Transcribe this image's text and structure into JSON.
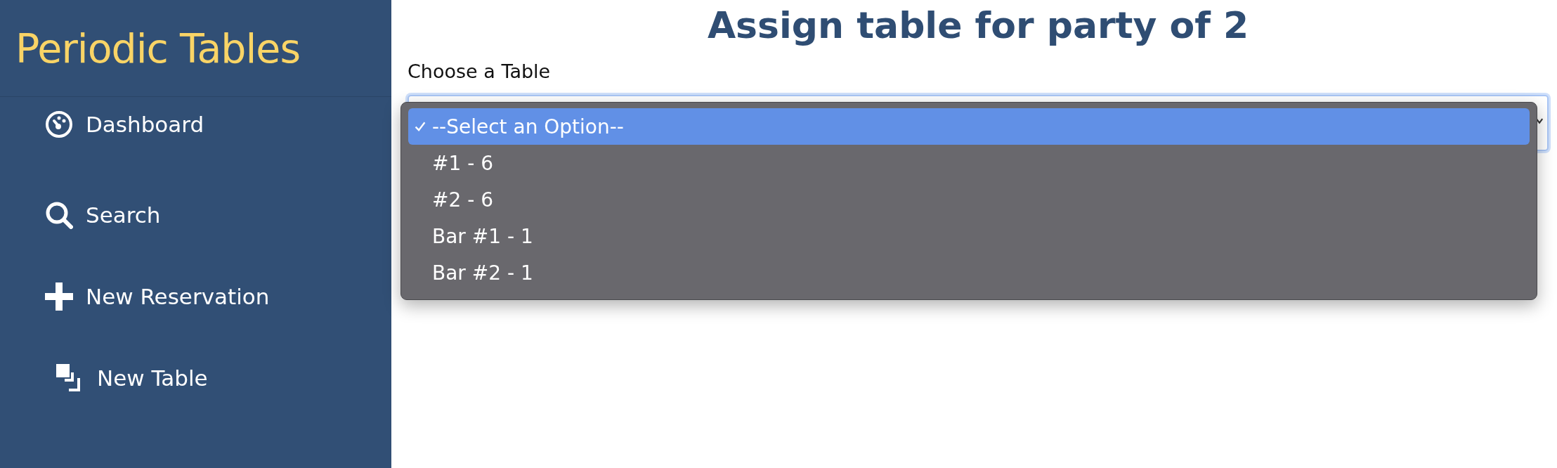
{
  "sidebar": {
    "brand": "Periodic Tables",
    "items": [
      {
        "label": "Dashboard",
        "kind": "dashboard"
      },
      {
        "label": "Search",
        "kind": "search"
      },
      {
        "label": "New Reservation",
        "kind": "plus"
      },
      {
        "label": "New Table",
        "kind": "table"
      }
    ]
  },
  "heading": "Assign table for party of 2",
  "form": {
    "label": "Choose a Table",
    "options": [
      {
        "label": "--Select an Option--",
        "selected": true
      },
      {
        "label": "#1 - 6",
        "selected": false
      },
      {
        "label": "#2 - 6",
        "selected": false
      },
      {
        "label": "Bar #1 - 1",
        "selected": false
      },
      {
        "label": "Bar #2 - 1",
        "selected": false
      }
    ]
  }
}
